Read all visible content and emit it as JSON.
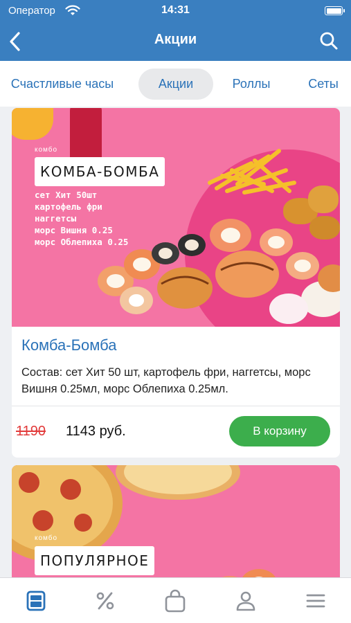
{
  "status": {
    "carrier": "Оператор",
    "time": "14:31"
  },
  "nav": {
    "title": "Акции",
    "back_icon": "chevron-left-icon",
    "search_icon": "search-icon"
  },
  "tabs": [
    {
      "label": "Счастливые часы",
      "active": false
    },
    {
      "label": "Акции",
      "active": true
    },
    {
      "label": "Роллы",
      "active": false
    },
    {
      "label": "Сеты",
      "active": false
    }
  ],
  "cards": [
    {
      "banner": {
        "small_label": "комбо",
        "tag": "КОМБА-БОМБА",
        "items": [
          "сет Хит 50шт",
          "картофель фри",
          "наггетсы",
          "морс Вишня 0.25",
          "морс Облепиха 0.25"
        ]
      },
      "title": "Комба-Бомба",
      "description": "Состав: сет Хит 50 шт, картофель фри, наггетсы, морс Вишня 0.25мл, морс Облепиха 0.25мл.",
      "old_price": "1190",
      "new_price": "1143 руб.",
      "cart_label": "В корзину"
    },
    {
      "banner": {
        "small_label": "комбо",
        "tag": "ПОПУЛЯРНОЕ"
      }
    }
  ],
  "tabbar": [
    {
      "icon": "menu-card-icon",
      "active": true
    },
    {
      "icon": "percent-icon",
      "active": false
    },
    {
      "icon": "shopping-bag-icon",
      "active": false
    },
    {
      "icon": "profile-icon",
      "active": false
    },
    {
      "icon": "hamburger-menu-icon",
      "active": false
    }
  ],
  "colors": {
    "primary": "#3a7fc0",
    "link": "#2a72b8",
    "banner_pink": "#f474a4",
    "cart_green": "#3cae4c",
    "old_price_red": "#e23b3b"
  }
}
